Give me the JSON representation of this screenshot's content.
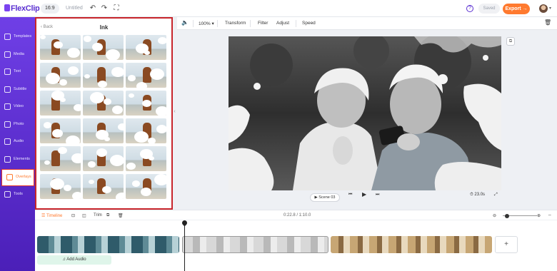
{
  "app": {
    "name": "FlexClip"
  },
  "header": {
    "aspect_ratio": "16:9",
    "project_name": "Untitled",
    "saved_label": "Saved",
    "export_label": "Export →",
    "help_glyph": "?",
    "icons": [
      "undo-icon",
      "redo-icon",
      "fullscreen-icon",
      "help-icon",
      "avatar"
    ]
  },
  "sidebar": {
    "items": [
      {
        "label": "Templates",
        "icon": "templates-icon"
      },
      {
        "label": "Media",
        "icon": "media-icon"
      },
      {
        "label": "Text",
        "icon": "text-icon"
      },
      {
        "label": "Subtitle",
        "icon": "subtitle-icon"
      },
      {
        "label": "Video",
        "icon": "video-icon"
      },
      {
        "label": "Photo",
        "icon": "photo-icon"
      },
      {
        "label": "Audio",
        "icon": "audio-icon"
      },
      {
        "label": "Elements",
        "icon": "elements-icon"
      },
      {
        "label": "Overlays",
        "icon": "overlays-icon",
        "active": true
      },
      {
        "label": "Tools",
        "icon": "tools-icon"
      }
    ],
    "accent": "#ff7a2f"
  },
  "panel": {
    "back_label": "Back",
    "title": "Ink",
    "thumbnail_count": 18
  },
  "toolbar": {
    "zoom": "100%",
    "items": [
      "Transform",
      "Filter",
      "Adjust",
      "Speed"
    ]
  },
  "player": {
    "scene_label": "Scene 03",
    "duration": "23.0s"
  },
  "timeline": {
    "tab_label": "Timeline",
    "trim_label": "Trim",
    "time_display": "0:22.8 / 1:10.0",
    "add_audio_label": "Add Audio",
    "add_clip_glyph": "+"
  },
  "colors": {
    "brand_purple": "#6f3fe6",
    "export_orange": "#ff7a2f",
    "highlight_red": "#c8252b"
  }
}
